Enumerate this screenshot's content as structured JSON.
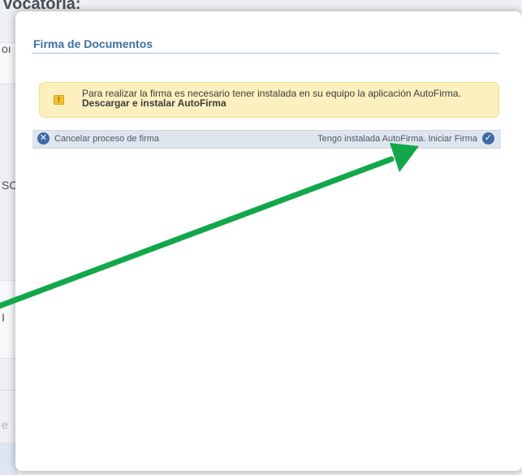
{
  "background": {
    "heading_fragment": "vocatoria:",
    "fragments": [
      "oı",
      "SC",
      "I",
      "e"
    ]
  },
  "modal": {
    "title": "Firma de Documentos",
    "alert": {
      "icon": "warning-icon",
      "text": "Para realizar la firma es necesario tener instalada en su equipo la aplicación AutoFirma.",
      "link_label": "Descargar e instalar AutoFirma"
    },
    "actions": {
      "cancel_label": "Cancelar proceso de firma",
      "cancel_icon": "close-circle-icon",
      "start_label": "Tengo instalada AutoFirma. Iniciar Firma",
      "start_icon": "check-circle-icon"
    }
  },
  "annotation": {
    "arrow_color": "#12a84a"
  }
}
